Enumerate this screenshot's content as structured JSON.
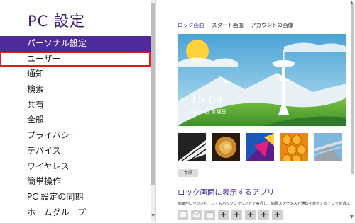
{
  "left": {
    "title": "PC 設定",
    "nav": [
      {
        "label": "パーソナル設定"
      },
      {
        "label": "ユーザー"
      },
      {
        "label": "通知"
      },
      {
        "label": "検索"
      },
      {
        "label": "共有"
      },
      {
        "label": "全般"
      },
      {
        "label": "プライバシー"
      },
      {
        "label": "デバイス"
      },
      {
        "label": "ワイヤレス"
      },
      {
        "label": "簡単操作"
      },
      {
        "label": "PC 設定の同期"
      },
      {
        "label": "ホームグループ"
      }
    ]
  },
  "right": {
    "tabs": [
      {
        "label": "ロック画面"
      },
      {
        "label": "スタート画面"
      },
      {
        "label": "アカウントの画像"
      }
    ],
    "lock": {
      "time": "15:04",
      "date": "8月29日 水曜日"
    },
    "browse_label": "参照",
    "section_title": "ロック画面に表示するアプリ",
    "section_desc": "画面がロックされていてもバックグラウンドで実行し、簡易ステータスと通知を表示するアプリを選ぶ",
    "add_glyph": "+"
  },
  "colors": {
    "accent": "#4d2b9a",
    "highlight_border": "#e01b1b"
  }
}
